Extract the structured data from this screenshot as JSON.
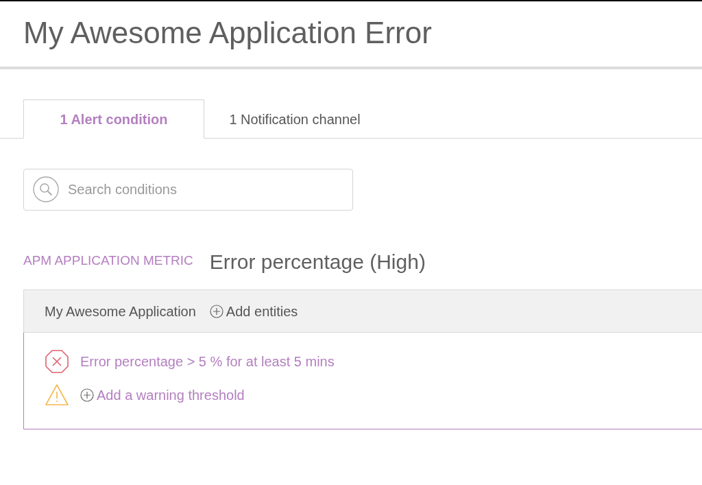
{
  "page": {
    "title": "My Awesome Application Error"
  },
  "tabs": [
    {
      "label": "1 Alert condition",
      "selected": true
    },
    {
      "label": "1 Notification channel",
      "selected": false
    }
  ],
  "search": {
    "placeholder": "Search conditions"
  },
  "condition": {
    "type": "APM APPLICATION METRIC",
    "name": "Error percentage (High)",
    "entity": "My Awesome Application",
    "add_entities": "Add entities",
    "thresholds": [
      {
        "kind": "critical",
        "text": "Error percentage > 5 % for at least 5 mins"
      },
      {
        "kind": "warning",
        "text": "Add a warning threshold"
      }
    ]
  }
}
